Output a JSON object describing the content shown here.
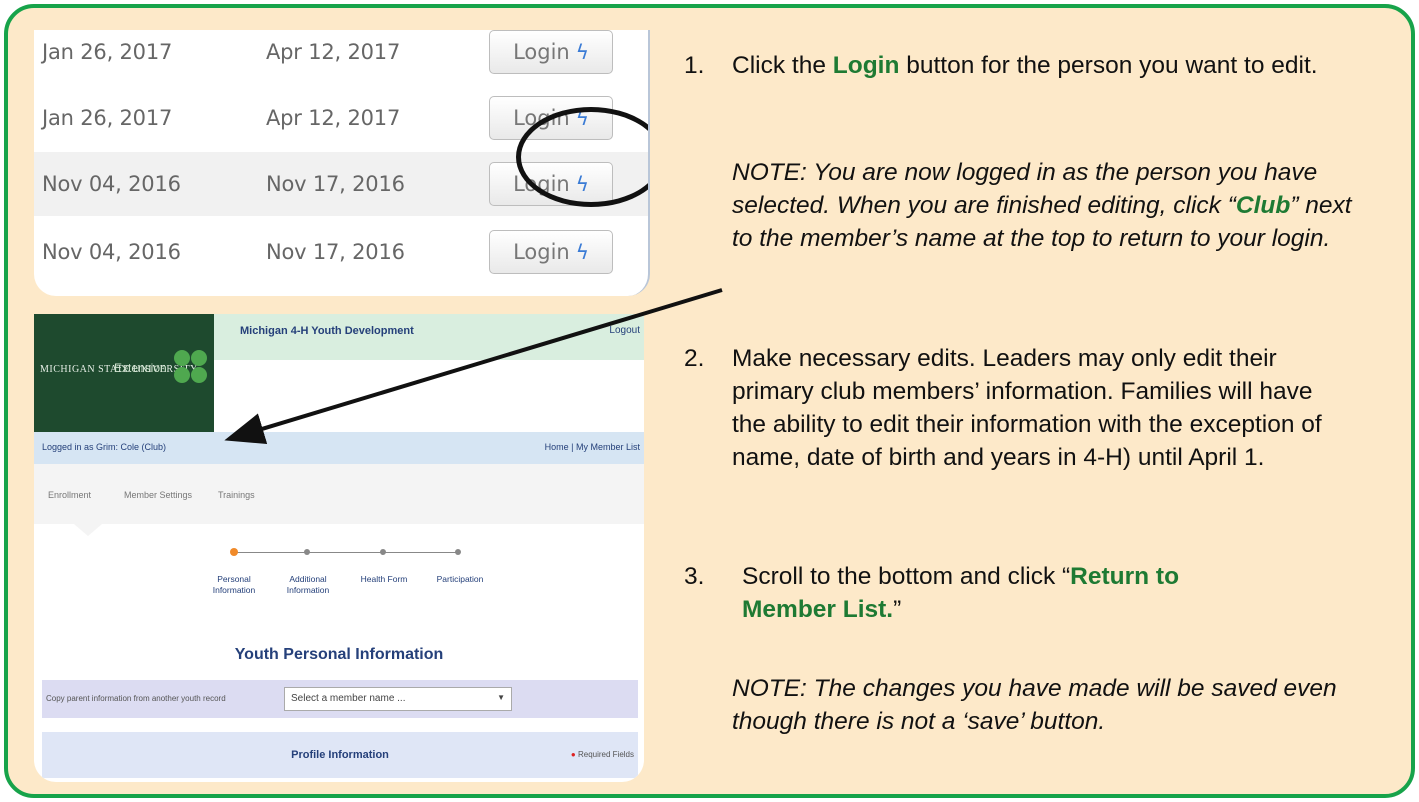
{
  "top_rows": [
    {
      "start": "Jan 26, 2017",
      "end": "Apr 12, 2017",
      "button": "Login"
    },
    {
      "start": "Jan 26, 2017",
      "end": "Apr 12, 2017",
      "button": "Login"
    },
    {
      "start": "Nov 04, 2016",
      "end": "Nov 17, 2016",
      "button": "Login"
    },
    {
      "start": "Nov 04, 2016",
      "end": "Nov 17, 2016",
      "button": "Login"
    }
  ],
  "page": {
    "logo_university": "MICHIGAN STATE UNIVERSITY",
    "logo_ext": "Extension",
    "header_title": "Michigan 4-H Youth Development",
    "logout": "Logout",
    "logged_in": "Logged in as Grim: Cole (Club)",
    "nav_right": "Home | My Member List",
    "tabs": [
      "Enrollment",
      "Member Settings",
      "Trainings"
    ],
    "steps": [
      "Personal Information",
      "Additional Information",
      "Health Form",
      "Participation"
    ],
    "section_title": "Youth Personal Information",
    "copy_label": "Copy parent information from another youth record",
    "select_placeholder": "Select a member name ...",
    "profile_title": "Profile Information",
    "required": "Required Fields"
  },
  "instructions": {
    "n1": "1.",
    "s1_pre": "Click the ",
    "s1_bold": "Login",
    "s1_post": " button for the person you want to edit.",
    "note1_a": "NOTE: You are now logged in as the person you have selected. When you are finished editing, click “",
    "note1_bold": "Club",
    "note1_b": "” next to the member’s name at the top to return to your login.",
    "n2": "2.",
    "s2": "Make necessary edits. Leaders may only edit their primary club members’ information. Families will have the ability to edit their information with the exception of name, date of birth and years in 4-H) until April 1.",
    "n3": "3.",
    "s3_pre": "Scroll to the bottom and click “",
    "s3_bold": "Return to Member List.",
    "s3_post": "”",
    "note3": "NOTE: The changes you have made will be saved even though there is not a ‘save’ button."
  },
  "colors": {
    "frame_border": "#17a34a",
    "background": "#fde9c9",
    "accent_green": "#1e7a33"
  }
}
